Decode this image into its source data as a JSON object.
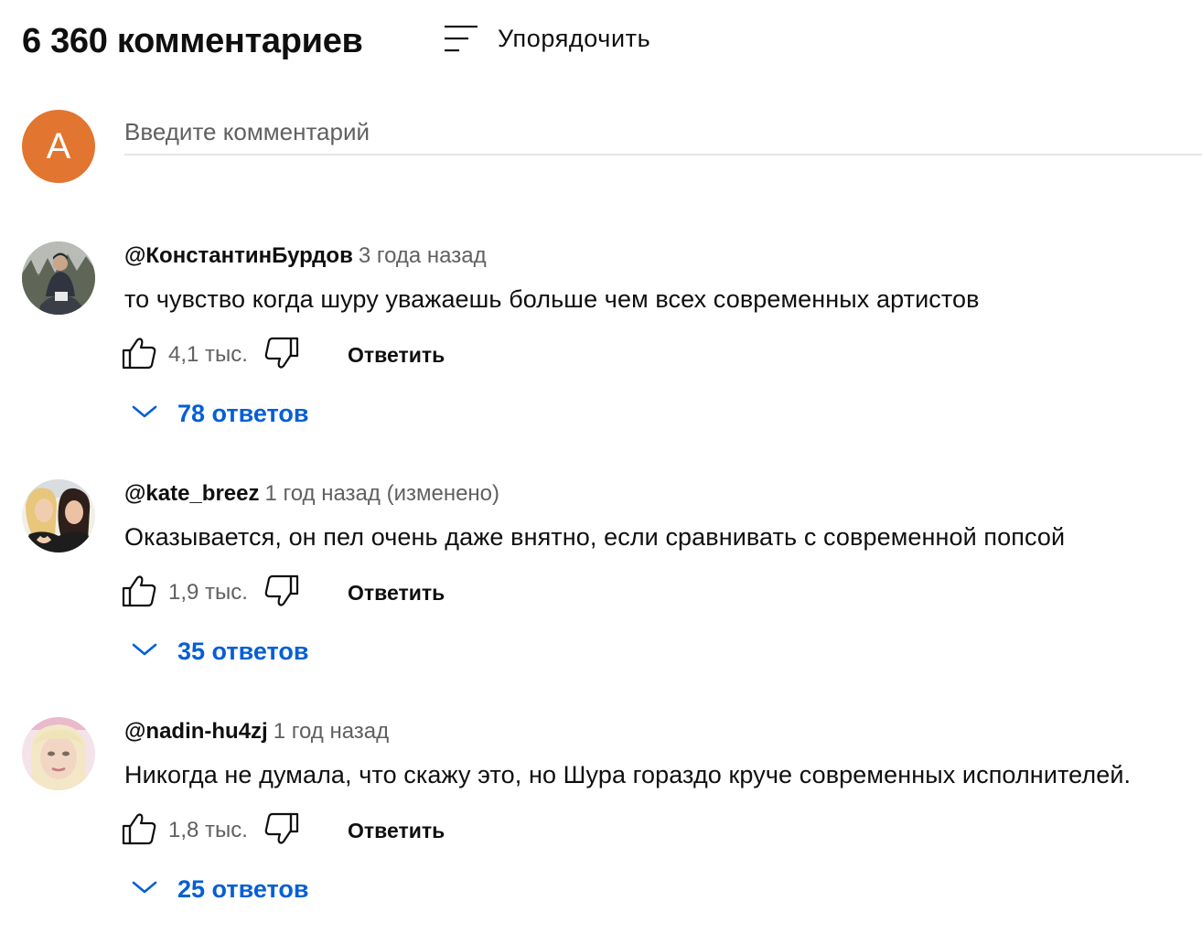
{
  "header": {
    "comment_count": "6 360 комментариев",
    "sort_label": "Упорядочить"
  },
  "composer": {
    "avatar_letter": "A",
    "avatar_color": "#e2752f",
    "placeholder": "Введите комментарий"
  },
  "comments": [
    {
      "author": "@КонстантинБурдов",
      "time": "3 года назад",
      "text": "то чувство когда шуру уважаешь больше чем всех современных артистов",
      "likes": "4,1 тыс.",
      "reply_label": "Ответить",
      "replies_label": "78 ответов"
    },
    {
      "author": "@kate_breez",
      "time": "1 год назад (изменено)",
      "text": "Оказывается, он пел очень даже внятно, если сравнивать с современной попсой",
      "likes": "1,9 тыс.",
      "reply_label": "Ответить",
      "replies_label": "35 ответов"
    },
    {
      "author": "@nadin-hu4zj",
      "time": "1 год назад",
      "text": "Никогда не думала, что скажу это, но Шура гораздо круче современных исполнителей.",
      "likes": "1,8 тыс.",
      "reply_label": "Ответить",
      "replies_label": "25 ответов"
    }
  ],
  "icons": {
    "sort": "sort-icon",
    "like": "thumbs-up-icon",
    "dislike": "thumbs-down-icon",
    "expand": "chevron-down-icon"
  },
  "colors": {
    "link_blue": "#065fd4",
    "secondary_text": "#606060",
    "primary_text": "#0f0f0f"
  }
}
